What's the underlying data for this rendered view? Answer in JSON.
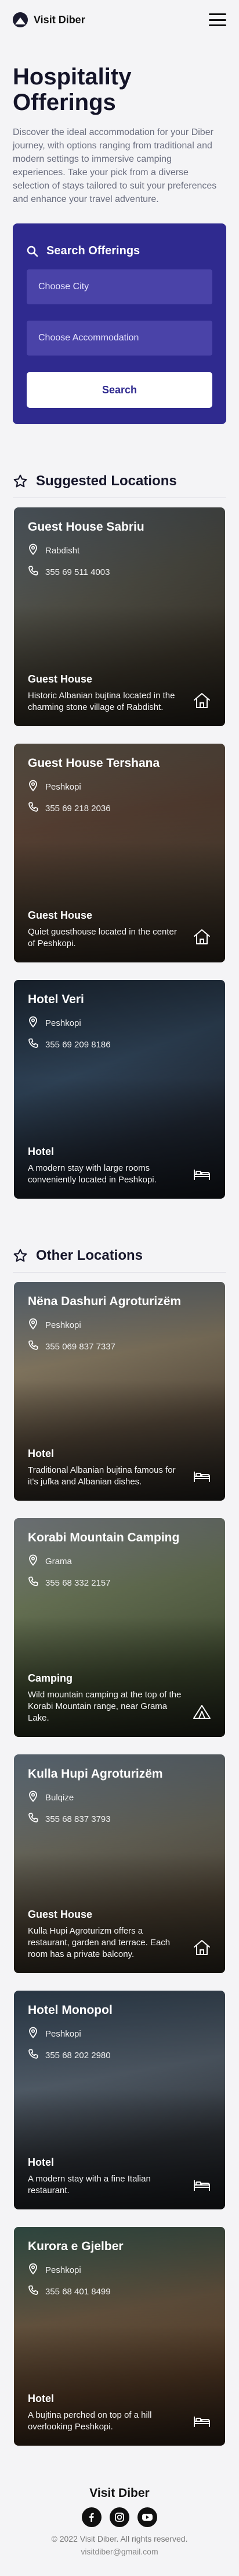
{
  "brand": {
    "name": "Visit Diber"
  },
  "hero": {
    "title": "Hospitality Offerings",
    "text": "Discover the ideal accommodation for your Diber journey, with options ranging from traditional and modern settings to immersive camping experiences. Take your pick from a diverse selection of stays tailored to suit your preferences and enhance your travel adventure."
  },
  "search": {
    "title": "Search Offerings",
    "city_placeholder": "Choose City",
    "accommodation_placeholder": "Choose Accommodation",
    "button": "Search"
  },
  "suggested": {
    "heading": "Suggested Locations",
    "items": [
      {
        "name": "Guest House Sabriu",
        "city": "Rabdisht",
        "phone": "355 69 511 4003",
        "type": "Guest House",
        "desc": "Historic Albanian bujtina located in the charming stone village of Rabdisht.",
        "icon": "house-icon"
      },
      {
        "name": "Guest House Tershana",
        "city": "Peshkopi",
        "phone": "355 69 218 2036",
        "type": "Guest House",
        "desc": "Quiet guesthouse located in the center of Peshkopi.",
        "icon": "house-icon"
      },
      {
        "name": "Hotel Veri",
        "city": "Peshkopi",
        "phone": "355 69 209 8186",
        "type": "Hotel",
        "desc": "A modern stay with large rooms conveniently located in Peshkopi.",
        "icon": "bed-icon"
      }
    ]
  },
  "other": {
    "heading": "Other Locations",
    "items": [
      {
        "name": "Nëna Dashuri Agroturizëm",
        "city": "Peshkopi",
        "phone": "355 069 837 7337",
        "type": "Hotel",
        "desc": "Traditional Albanian bujtina famous for it's jufka and Albanian dishes.",
        "icon": "bed-icon"
      },
      {
        "name": "Korabi Mountain Camping",
        "city": "Grama",
        "phone": "355 68 332 2157",
        "type": "Camping",
        "desc": "Wild mountain camping at the top of the Korabi Mountain range, near Grama Lake.",
        "icon": "tent-icon"
      },
      {
        "name": "Kulla Hupi Agroturizëm",
        "city": "Bulqize",
        "phone": "355 68 837 3793",
        "type": "Guest House",
        "desc": "Kulla Hupi Agroturizm offers a restaurant, garden and terrace. Each room has a private balcony.",
        "icon": "house-icon"
      },
      {
        "name": "Hotel Monopol",
        "city": "Peshkopi",
        "phone": "355 68 202 2980",
        "type": "Hotel",
        "desc": "A modern stay with a fine Italian restaurant.",
        "icon": "bed-icon"
      },
      {
        "name": "Kurora e Gjelber",
        "city": "Peshkopi",
        "phone": "355 68 401 8499",
        "type": "Hotel",
        "desc": "A bujtina perched on top of a hill overlooking Peshkopi.",
        "icon": "bed-icon"
      }
    ]
  },
  "footer": {
    "brand": "Visit Diber",
    "socials": [
      "facebook-icon",
      "instagram-icon",
      "youtube-icon"
    ],
    "copyright": "© 2022 Visit Diber. All rights reserved.",
    "email": "visitdiber@gmail.com"
  }
}
